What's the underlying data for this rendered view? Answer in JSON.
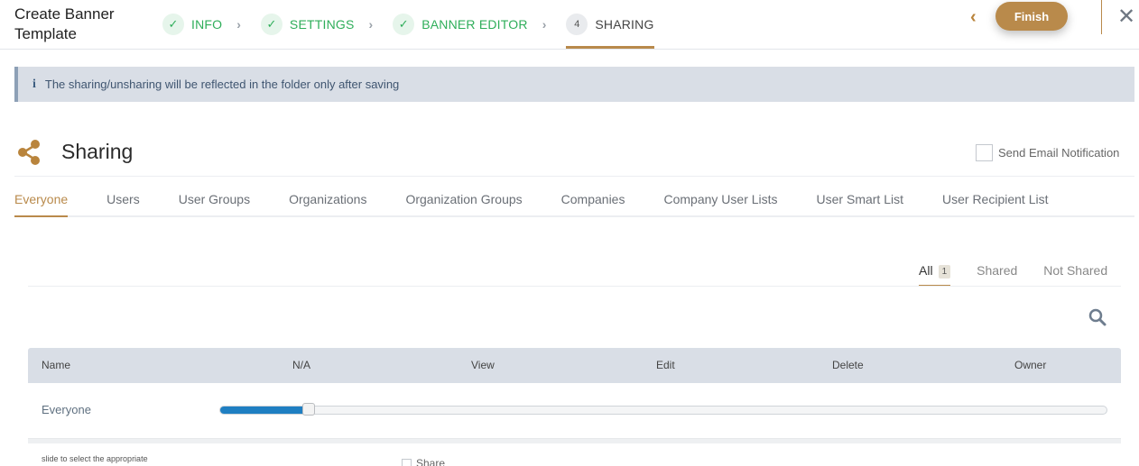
{
  "header": {
    "title": "Create Banner Template",
    "steps": [
      {
        "number": "",
        "label": "INFO",
        "status": "done"
      },
      {
        "number": "",
        "label": "SETTINGS",
        "status": "done"
      },
      {
        "number": "",
        "label": "BANNER EDITOR",
        "status": "done"
      },
      {
        "number": "4",
        "label": "SHARING",
        "status": "active"
      }
    ],
    "finish_label": "Finish",
    "check_glyph": "✓",
    "separator_glyph": "›",
    "back_glyph": "‹",
    "close_glyph": "✕"
  },
  "info_banner": {
    "icon": "info-icon",
    "icon_glyph": "i",
    "text": "The sharing/unsharing will be reflected in the folder only after saving"
  },
  "sharing": {
    "title": "Sharing",
    "email_notification_label": "Send Email Notification",
    "email_notification_checked": false
  },
  "tabs": [
    {
      "label": "Everyone",
      "active": true
    },
    {
      "label": "Users",
      "active": false
    },
    {
      "label": "User Groups",
      "active": false
    },
    {
      "label": "Organizations",
      "active": false
    },
    {
      "label": "Organization Groups",
      "active": false
    },
    {
      "label": "Companies",
      "active": false
    },
    {
      "label": "Company User Lists",
      "active": false
    },
    {
      "label": "User Smart List",
      "active": false
    },
    {
      "label": "User Recipient List",
      "active": false
    }
  ],
  "filters": {
    "all_label": "All",
    "all_count": "1",
    "shared_label": "Shared",
    "not_shared_label": "Not Shared"
  },
  "table": {
    "columns": [
      "Name",
      "N/A",
      "View",
      "Edit",
      "Delete",
      "Owner"
    ],
    "rows": [
      {
        "name": "Everyone",
        "permission_level_fraction": 0.1
      }
    ],
    "hint_text": "slide to select the appropriate",
    "share_label": "Share",
    "share_checked": false
  },
  "colors": {
    "accent": "#b98a4b",
    "success": "#2fae5a",
    "slider_fill": "#1f7fc2",
    "banner_bg": "#d9dee6"
  }
}
